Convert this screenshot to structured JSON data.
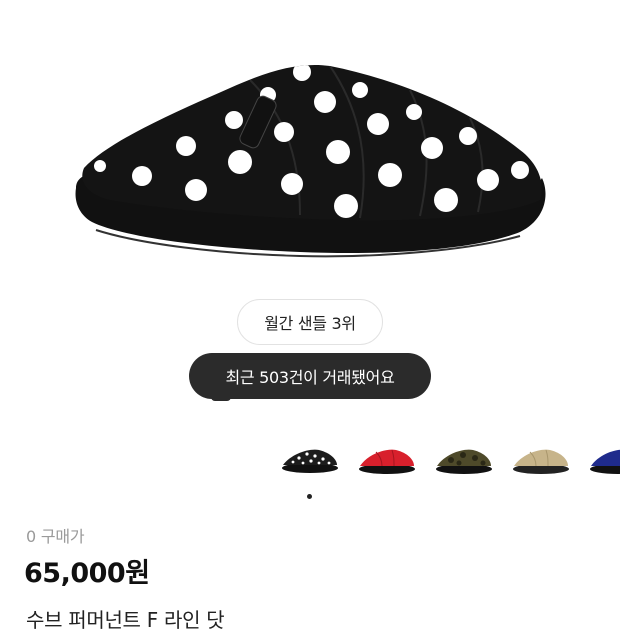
{
  "ranking_badge": "월간 샌들 3위",
  "trade_count": "최근 503건이 거래됐어요",
  "thumbnails": [
    {
      "icon": "black-polka-dot-slipper-thumbnail",
      "color": "#1c1c1c"
    },
    {
      "icon": "red-slipper-thumbnail",
      "color": "#d8202c"
    },
    {
      "icon": "olive-camo-slipper-thumbnail",
      "color": "#4e4a2a"
    },
    {
      "icon": "beige-slipper-thumbnail",
      "color": "#c7b48a"
    },
    {
      "icon": "navy-slipper-thumbnail",
      "color": "#1f2b8c"
    }
  ],
  "price": {
    "label": "0 구매가",
    "value": "65,000원"
  },
  "product_name": "수브 퍼머넌트 F 라인 닷"
}
